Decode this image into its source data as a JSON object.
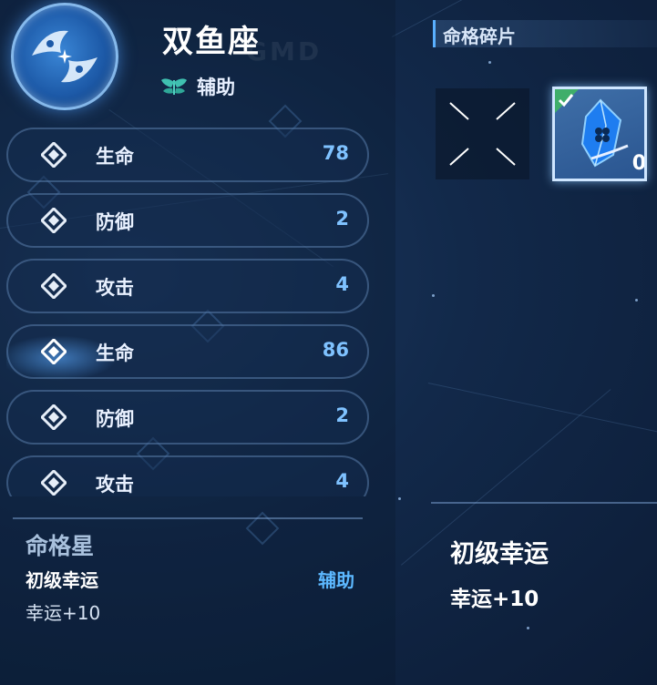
{
  "header": {
    "constellation_name": "双鱼座",
    "role_label": "辅助",
    "emblem_icon": "pisces-emblem-icon",
    "role_icon": "support-wings-icon"
  },
  "stats": [
    {
      "name": "生命",
      "value": "78"
    },
    {
      "name": "防御",
      "value": "2"
    },
    {
      "name": "攻击",
      "value": "4"
    },
    {
      "name": "生命",
      "value": "86"
    },
    {
      "name": "防御",
      "value": "2"
    },
    {
      "name": "攻击",
      "value": "4"
    }
  ],
  "star_info": {
    "header": "命格星",
    "name": "初级幸运",
    "role": "辅助",
    "effect": "幸运+10"
  },
  "fragments": {
    "title": "命格碎片",
    "item_count": "0",
    "item_icon": "blue-crystal-fragment-icon",
    "selected_icon": "checkmark-icon"
  },
  "detail": {
    "name": "初级幸运",
    "effect": "幸运+10"
  },
  "colors": {
    "background": "#12294a",
    "accent_blue": "#5cb8ff",
    "value_blue": "#7fc2ff"
  }
}
